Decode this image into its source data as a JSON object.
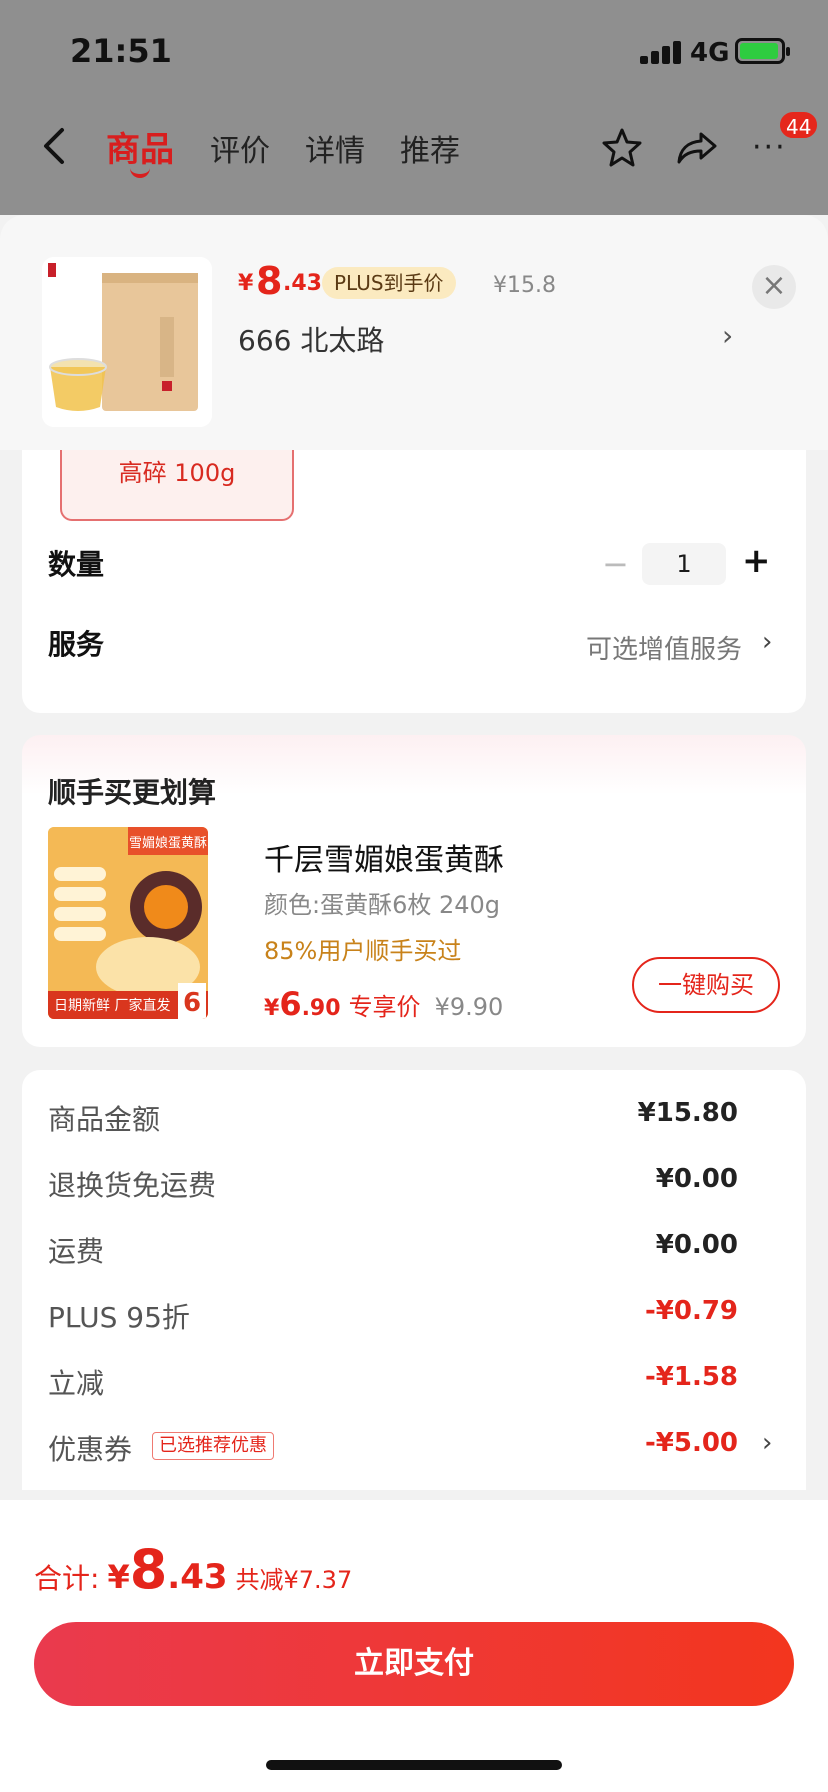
{
  "status_bar": {
    "time": "21:51",
    "network": "4G"
  },
  "nav": {
    "tabs": [
      {
        "label": "商品",
        "active": true
      },
      {
        "label": "评价",
        "active": false
      },
      {
        "label": "详情",
        "active": false
      },
      {
        "label": "推荐",
        "active": false
      }
    ],
    "badge_count": "44"
  },
  "product": {
    "price_currency": "¥",
    "price_int": "8",
    "price_dec": ".43",
    "plus_tag": "PLUS到手价",
    "original_price": "¥15.8",
    "address": "666  北太路"
  },
  "spec": {
    "selected_option": "高碎 100g"
  },
  "quantity": {
    "label": "数量",
    "value": "1",
    "minus": "−",
    "plus": "+"
  },
  "service": {
    "label": "服务",
    "value": "可选增值服务"
  },
  "upsell": {
    "title": "顺手买更划算",
    "item_name": "千层雪媚娘蛋黄酥",
    "item_spec": "颜色:蛋黄酥6枚 240g",
    "buy_rate": "85%用户顺手买过",
    "price_currency": "¥",
    "price_int": "6",
    "price_dec": ".90",
    "price_tag": "专享价",
    "original_price": "¥9.90",
    "buy_button": "一键购买",
    "image_caption_top": "雪媚娘蛋黄酥",
    "image_caption_bottom": "日期新鲜 厂家直发",
    "image_badge": "6"
  },
  "fees": [
    {
      "label": "商品金额",
      "value": "¥15.80",
      "discount": false
    },
    {
      "label": "退换货免运费",
      "value": "¥0.00",
      "discount": false
    },
    {
      "label": "运费",
      "value": "¥0.00",
      "discount": false
    },
    {
      "label": "PLUS 95折",
      "value": "-¥0.79",
      "discount": true
    },
    {
      "label": "立减",
      "value": "-¥1.58",
      "discount": true
    },
    {
      "label": "优惠券",
      "value": "-¥5.00",
      "discount": true,
      "tag": "已选推荐优惠"
    }
  ],
  "footer": {
    "total_label": "合计:",
    "total_currency": "¥",
    "total_int": "8",
    "total_dec": ".43",
    "total_saved": "共减¥7.37",
    "pay_button": "立即支付"
  },
  "colors": {
    "accent": "#e4251b",
    "plus_tag_bg": "#fbeac0"
  }
}
